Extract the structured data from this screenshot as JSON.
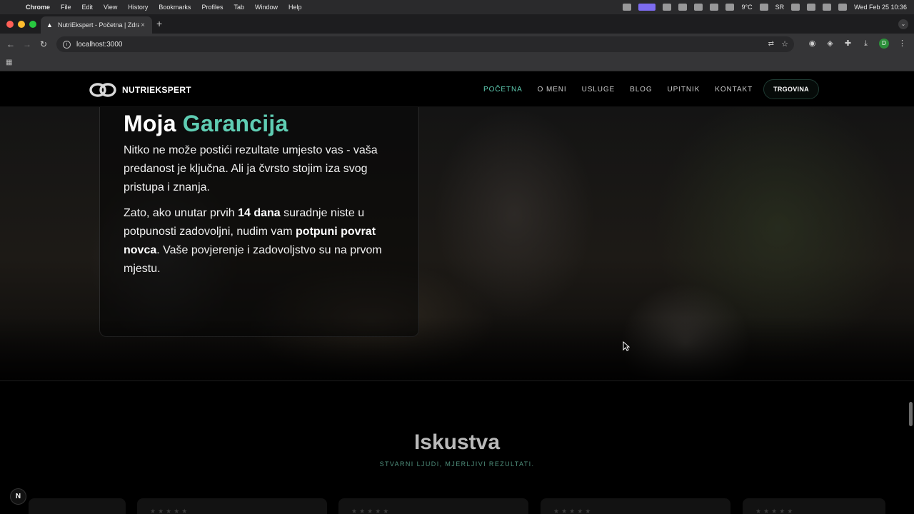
{
  "menubar": {
    "app_name": "Chrome",
    "menus": [
      "File",
      "Edit",
      "View",
      "History",
      "Bookmarks",
      "Profiles",
      "Tab",
      "Window",
      "Help"
    ],
    "temperature": "9°C",
    "keyboard_layout": "SR",
    "datetime": "Wed Feb 25  10:36"
  },
  "browser": {
    "tab_title": "NutriEkspert - Početna | Zdra",
    "url": "localhost:3000",
    "profile_initial": "D"
  },
  "site": {
    "logo_text": "NUTRIEKSPERT",
    "nav": {
      "home": "POČETNA",
      "about": "O MENI",
      "services": "USLUGE",
      "blog": "BLOG",
      "questionnaire": "UPITNIK",
      "contact": "KONTAKT"
    },
    "shop_button": "TRGOVINA",
    "accent_color": "#5fcdb3"
  },
  "guarantee": {
    "title_prefix": "Moja",
    "title_accent": "Garancija",
    "p1": [
      "Nitko ne može postići rezultate umjesto vas - vaša",
      "predanost je ključna. Ali ja čvrsto stojim iza svog",
      "pristupa i znanja."
    ],
    "p2": {
      "l1_a": "Zato, ako unutar prvih ",
      "l1_b": "14 dana",
      "l1_c": " suradnje niste u",
      "l2_a": "potpunosti zadovoljni, nudim vam ",
      "l2_b": "potpuni povrat",
      "l3_a": "novca",
      "l3_b": ". Vaše povjerenje i zadovoljstvo su na prvom",
      "l4": "mjestu."
    }
  },
  "testimonials": {
    "title": "Iskustva",
    "subtitle": "STVARNI LJUDI, MJERLJIVI REZULTATI.",
    "stars": "★★★★★"
  },
  "next_badge": "N"
}
